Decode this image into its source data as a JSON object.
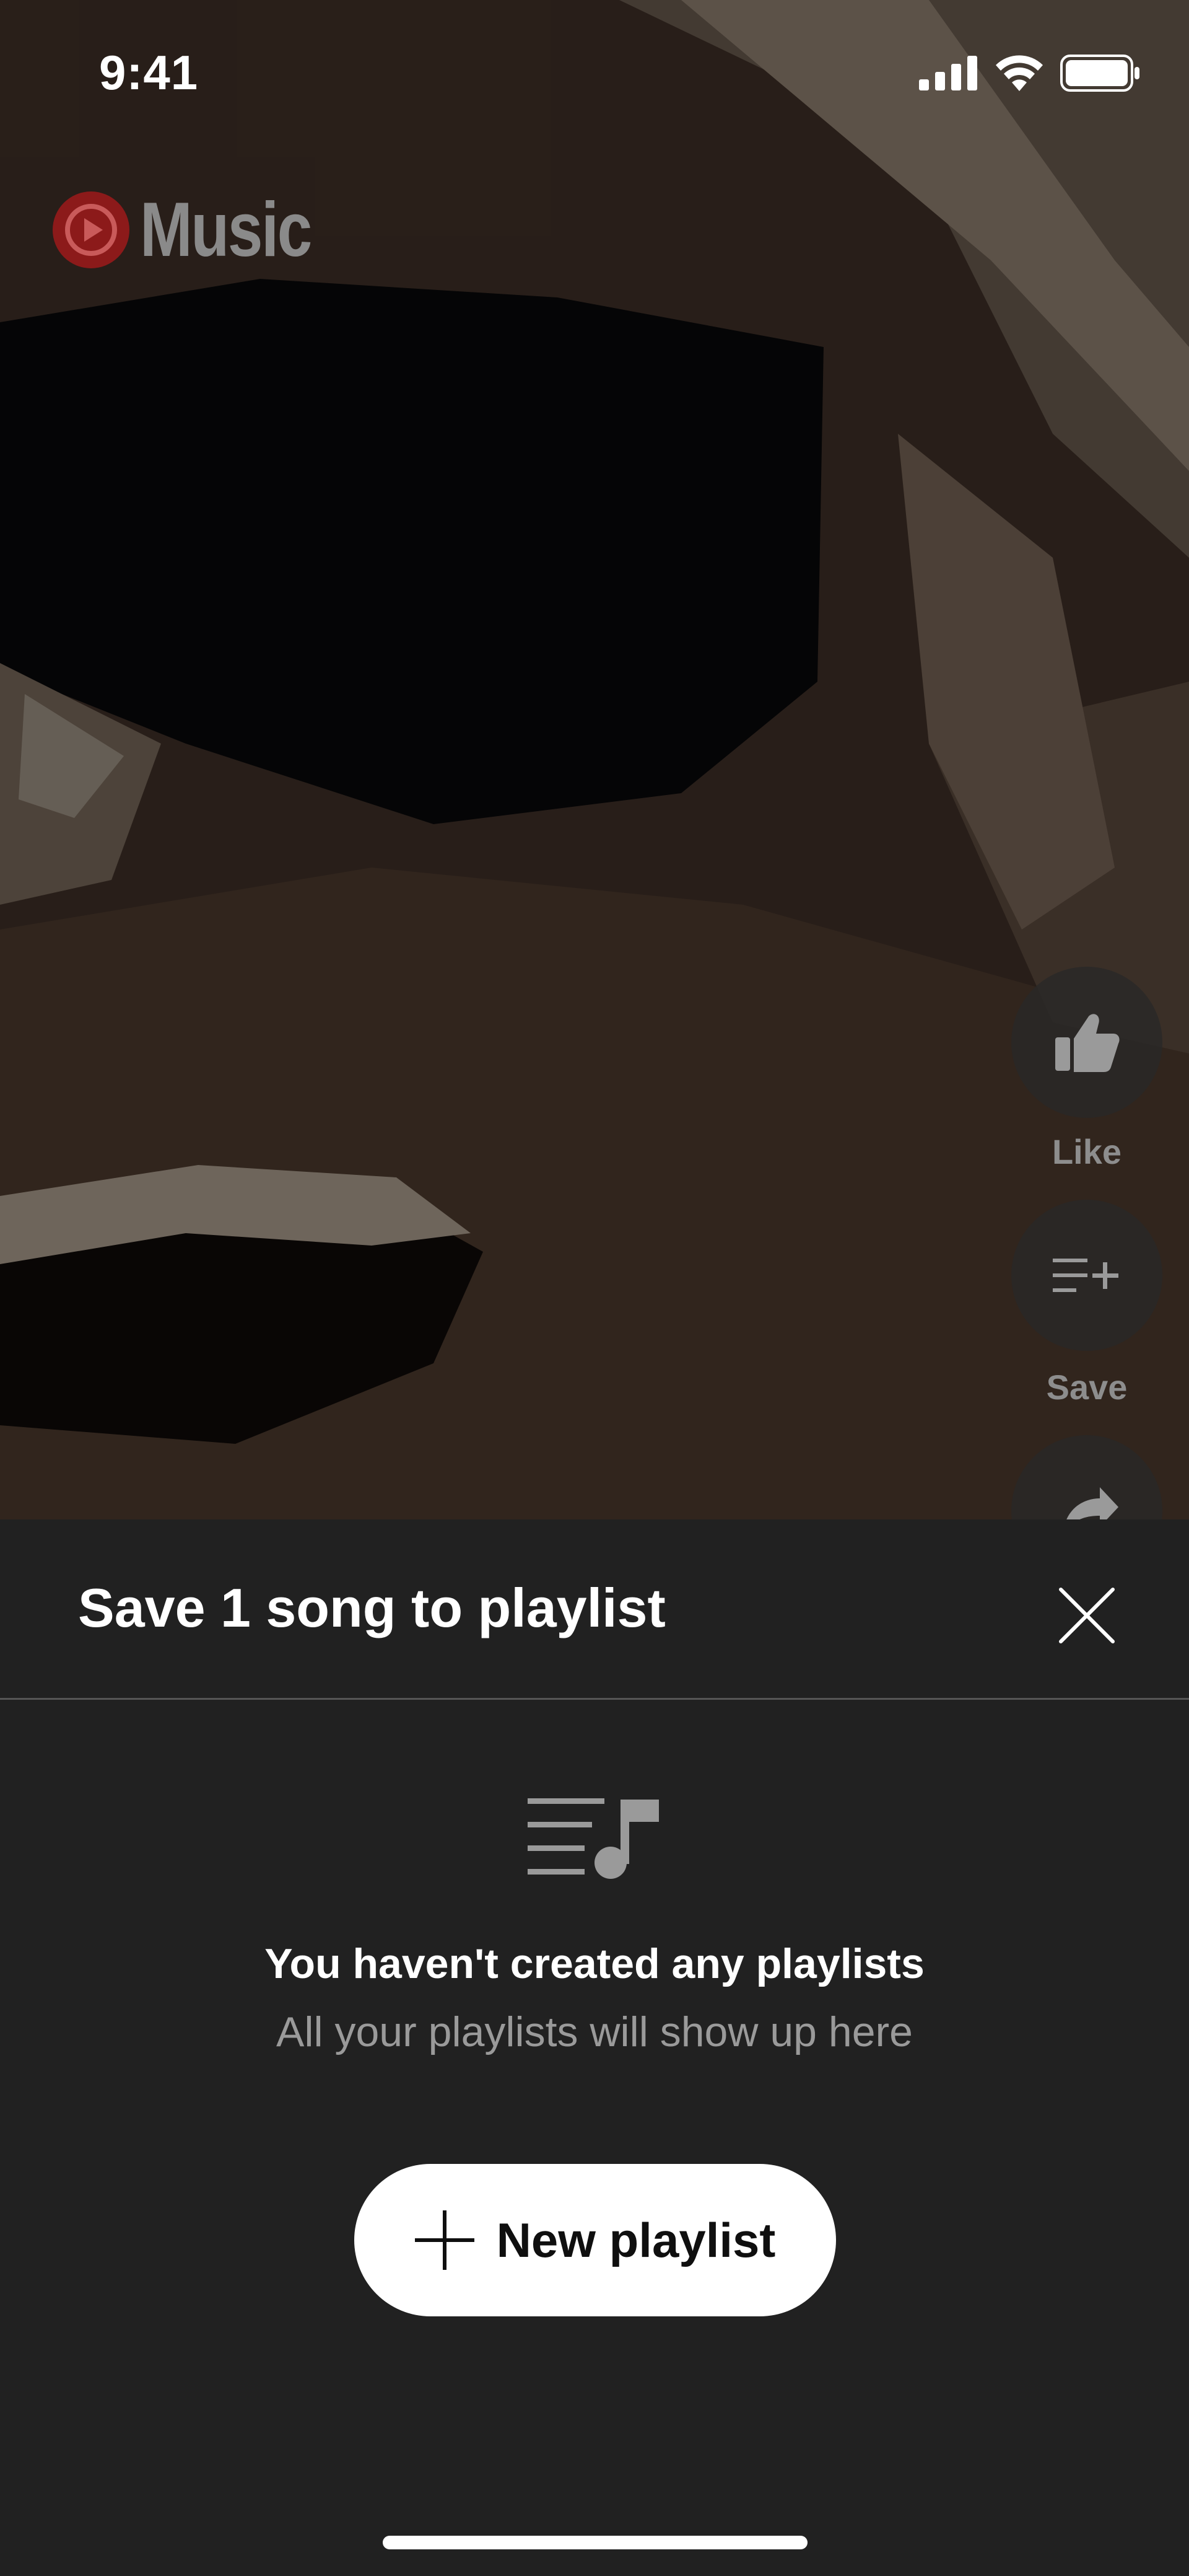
{
  "status_bar": {
    "time": "9:41",
    "icons": [
      "cellular-signal-icon",
      "wifi-icon",
      "battery-icon"
    ]
  },
  "app": {
    "logo_text": "Music",
    "brand_color": "#e53935"
  },
  "actions": {
    "like_label": "Like",
    "save_label": "Save",
    "partial_icon": "share-icon"
  },
  "sheet": {
    "title": "Save 1 song to playlist",
    "close_icon": "close-icon",
    "empty_icon": "playlist-music-icon",
    "empty_title": "You haven't created any playlists",
    "empty_subtitle": "All your playlists will show up here",
    "new_playlist_label": "New playlist"
  },
  "colors": {
    "sheet_bg": "#212121",
    "button_bg": "#ffffff",
    "subtitle": "#9a9a9a"
  }
}
